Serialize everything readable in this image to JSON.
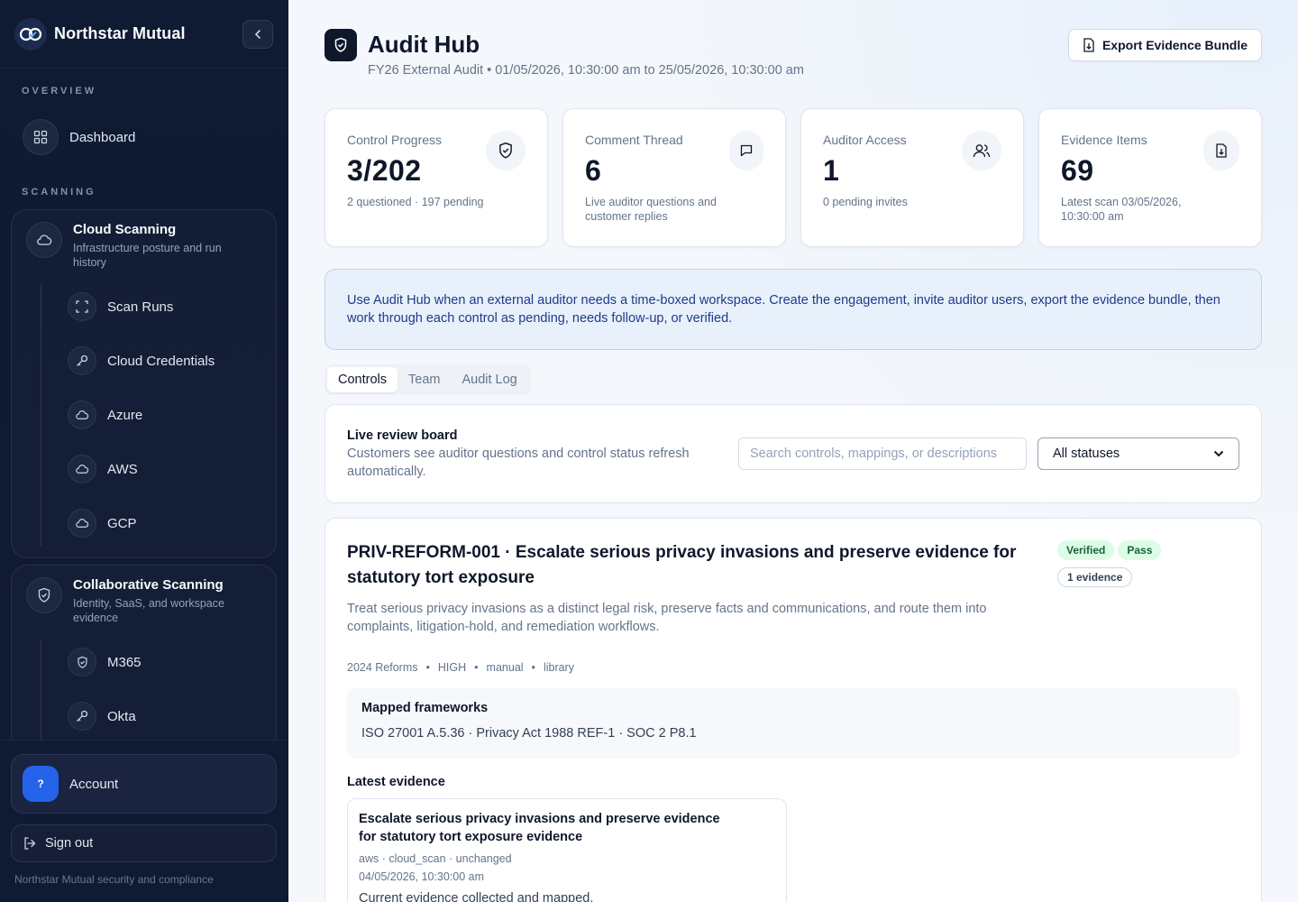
{
  "brand": {
    "name": "Northstar Mutual"
  },
  "sidebar": {
    "overview_label": "OVERVIEW",
    "dashboard_label": "Dashboard",
    "scanning_label": "SCANNING",
    "groups": [
      {
        "title": "Cloud Scanning",
        "subtitle": "Infrastructure posture and run history",
        "items": [
          "Scan Runs",
          "Cloud Credentials",
          "Azure",
          "AWS",
          "GCP"
        ]
      },
      {
        "title": "Collaborative Scanning",
        "subtitle": "Identity, SaaS, and workspace evidence",
        "items": [
          "M365",
          "Okta"
        ]
      }
    ],
    "account": {
      "avatar": "?",
      "label": "Account"
    },
    "signout_label": "Sign out",
    "footer": "Northstar Mutual security and compliance"
  },
  "header": {
    "title": "Audit Hub",
    "subtitle": "FY26 External Audit • 01/05/2026, 10:30:00 am to 25/05/2026, 10:30:00 am",
    "export_label": "Export Evidence Bundle"
  },
  "stats": [
    {
      "label": "Control Progress",
      "value": "3/202",
      "note": "2 questioned · 197 pending",
      "icon": "shield-check-icon"
    },
    {
      "label": "Comment Thread",
      "value": "6",
      "note": "Live auditor questions and customer replies",
      "icon": "message-icon"
    },
    {
      "label": "Auditor Access",
      "value": "1",
      "note": "0 pending invites",
      "icon": "users-icon"
    },
    {
      "label": "Evidence Items",
      "value": "69",
      "note": "Latest scan 03/05/2026, 10:30:00 am",
      "icon": "file-download-icon"
    }
  ],
  "banner": "Use Audit Hub when an external auditor needs a time-boxed workspace. Create the engagement, invite auditor users, export the evidence bundle, then work through each control as pending, needs follow-up, or verified.",
  "tabs": [
    "Controls",
    "Team",
    "Audit Log"
  ],
  "board": {
    "title": "Live review board",
    "subtitle": "Customers see auditor questions and control status refresh automatically.",
    "search_placeholder": "Search controls, mappings, or descriptions",
    "status_selected": "All statuses"
  },
  "control": {
    "title": "PRIV-REFORM-001 · Escalate serious privacy invasions and preserve evidence for statutory tort exposure",
    "description": "Treat serious privacy invasions as a distinct legal risk, preserve facts and communications, and route them into complaints, litigation-hold, and remediation workflows.",
    "badges": {
      "status": "Verified",
      "result": "Pass",
      "evidence": "1 evidence"
    },
    "meta": [
      "2024 Reforms",
      "HIGH",
      "manual",
      "library"
    ],
    "frameworks_title": "Mapped frameworks",
    "frameworks": "ISO 27001 A.5.36 · Privacy Act 1988 REF-1 · SOC 2 P8.1",
    "latest_evidence_title": "Latest evidence",
    "evidence": {
      "title": "Escalate serious privacy invasions and preserve evidence for statutory tort exposure evidence",
      "source": "aws · cloud_scan · unchanged",
      "timestamp": "04/05/2026, 10:30:00 am",
      "note": "Current evidence collected and mapped."
    }
  },
  "colors": {
    "sidebar_bg": "#0f1a33",
    "accent_blue": "#2563eb",
    "banner_bg": "#e8f1fb",
    "verified_bg": "#dcfce7"
  }
}
